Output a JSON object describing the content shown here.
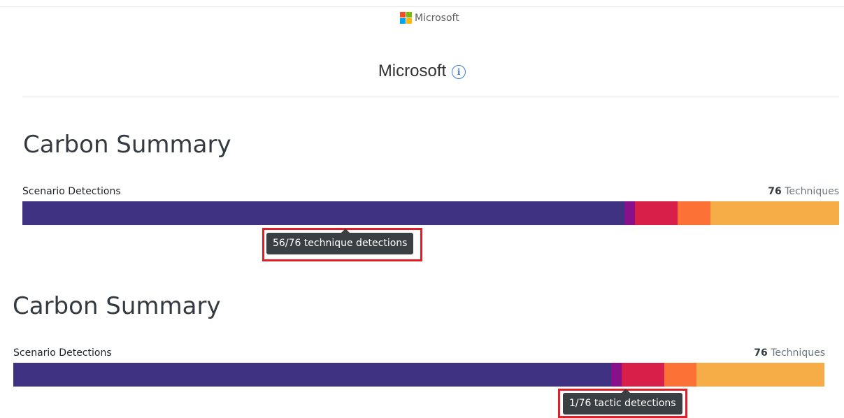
{
  "header": {
    "logo_text": "Microsoft",
    "logo_colors": [
      "#f25022",
      "#7fba00",
      "#00a4ef",
      "#ffb900"
    ],
    "org_title": "Microsoft",
    "info_icon": "info-circle-icon",
    "info_glyph": "i"
  },
  "panels": [
    {
      "title": "Carbon Summary",
      "bar_label": "Scenario Detections",
      "count_number": "76",
      "count_suffix": " Techniques",
      "tooltip": "56/76 technique detections",
      "segment_colors": [
        "#3f3282",
        "#88108a",
        "#d81f4a",
        "#fc7236",
        "#f6ac47"
      ],
      "segment_values": [
        56,
        1,
        4,
        3,
        12
      ]
    },
    {
      "title": "Carbon Summary",
      "bar_label": "Scenario Detections",
      "count_number": "76",
      "count_suffix": " Techniques",
      "tooltip": "1/76 tactic detections",
      "segment_colors": [
        "#3f3282",
        "#88108a",
        "#d81f4a",
        "#fc7236",
        "#f6ac47"
      ],
      "segment_values": [
        56,
        1,
        4,
        3,
        12
      ]
    }
  ]
}
